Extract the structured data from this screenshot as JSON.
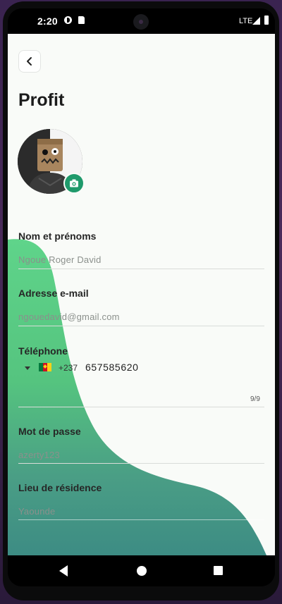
{
  "status_bar": {
    "time": "2:20",
    "network": "LTE",
    "icons": [
      "circle-app-icon",
      "sd-card-icon",
      "signal-icon",
      "battery-icon"
    ]
  },
  "header": {
    "back_icon": "chevron-left-icon",
    "title": "Profit"
  },
  "avatar": {
    "camera_icon": "camera-icon",
    "camera_color": "#1f9a6b"
  },
  "fields": {
    "name": {
      "label": "Nom et prénoms",
      "value": "Ngoue Roger David"
    },
    "email": {
      "label": "Adresse e-mail",
      "value": "ngouedavid@gmail.com"
    },
    "phone": {
      "label": "Téléphone",
      "country_flag": "cameroon-flag-icon",
      "dial_code": "+237",
      "number": "657585620",
      "counter": "9/9"
    },
    "password": {
      "label": "Mot de passe",
      "value": "azerty123"
    },
    "residence": {
      "label": "Lieu de résidence",
      "value": "Yaounde"
    }
  },
  "colors": {
    "wave_top": "#5fd48a",
    "wave_bottom": "#3d8c84",
    "background": "#f9fbf8"
  },
  "nav_bar": {
    "icons": [
      "nav-back-icon",
      "nav-home-icon",
      "nav-recents-icon"
    ]
  }
}
